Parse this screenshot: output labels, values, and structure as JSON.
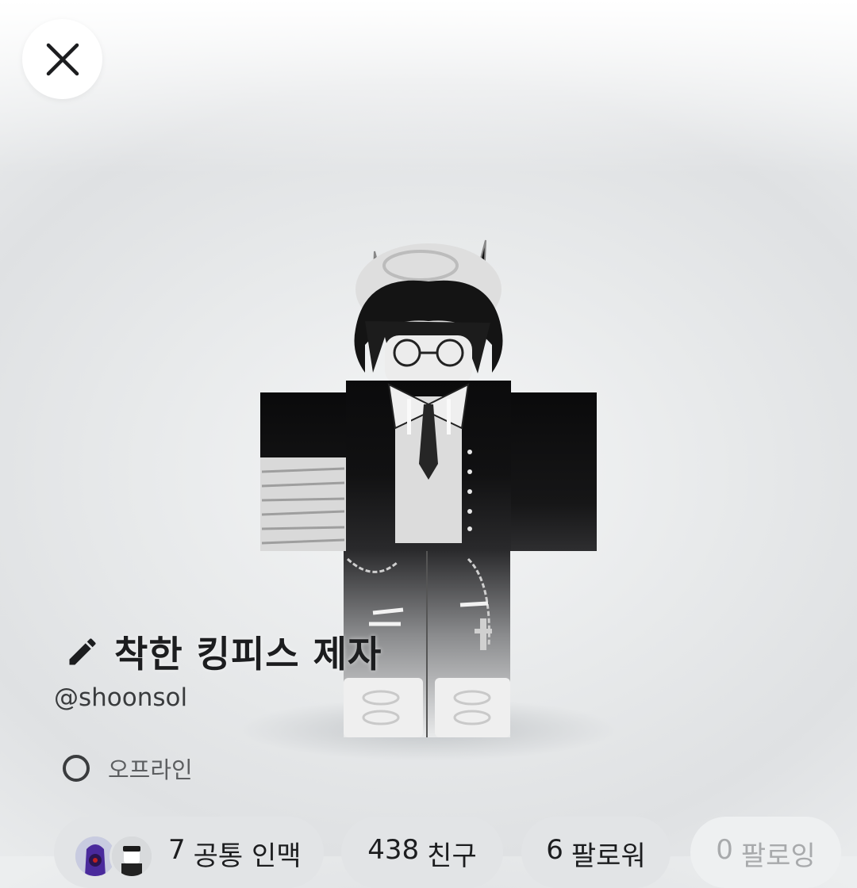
{
  "profile": {
    "display_name": "착한 킹피스 제자",
    "username": "@shoonsol",
    "status": "오프라인"
  },
  "stats": {
    "mutual_count": "7",
    "mutual_label": "공통 인맥",
    "friends_count": "438",
    "friends_label": "친구",
    "followers_count": "6",
    "followers_label": "팔로워",
    "following_count": "0",
    "following_label": "팔로잉"
  },
  "icons": {
    "close": "close-icon",
    "edit": "pencil-icon",
    "status": "offline-circle-icon"
  },
  "colors": {
    "text_primary": "#1c1d1f",
    "text_secondary": "#5c5e60",
    "pill_bg": "#e2e4e6"
  }
}
